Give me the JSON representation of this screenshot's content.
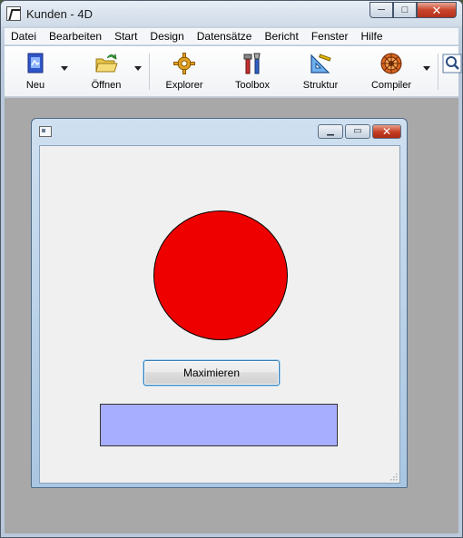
{
  "app": {
    "title": "Kunden - 4D",
    "caption": {
      "minimize": "─",
      "maximize": "□",
      "close": "✕"
    }
  },
  "menu": [
    "Datei",
    "Bearbeiten",
    "Start",
    "Design",
    "Datensätze",
    "Bericht",
    "Fenster",
    "Hilfe"
  ],
  "toolbar": {
    "new_label": "Neu",
    "open_label": "Öffnen",
    "explorer_label": "Explorer",
    "toolbox_label": "Toolbox",
    "structure_label": "Struktur",
    "compiler_label": "Compiler"
  },
  "form_window": {
    "caption": {
      "minimize": "▁",
      "maximize": "▭",
      "close": "✕"
    },
    "button_label": "Maximieren",
    "circle_color": "#ee0000",
    "rect_color": "#a7adff"
  },
  "colors": {
    "workspace": "#a8a8a8",
    "accent_close": "#c33c22"
  }
}
